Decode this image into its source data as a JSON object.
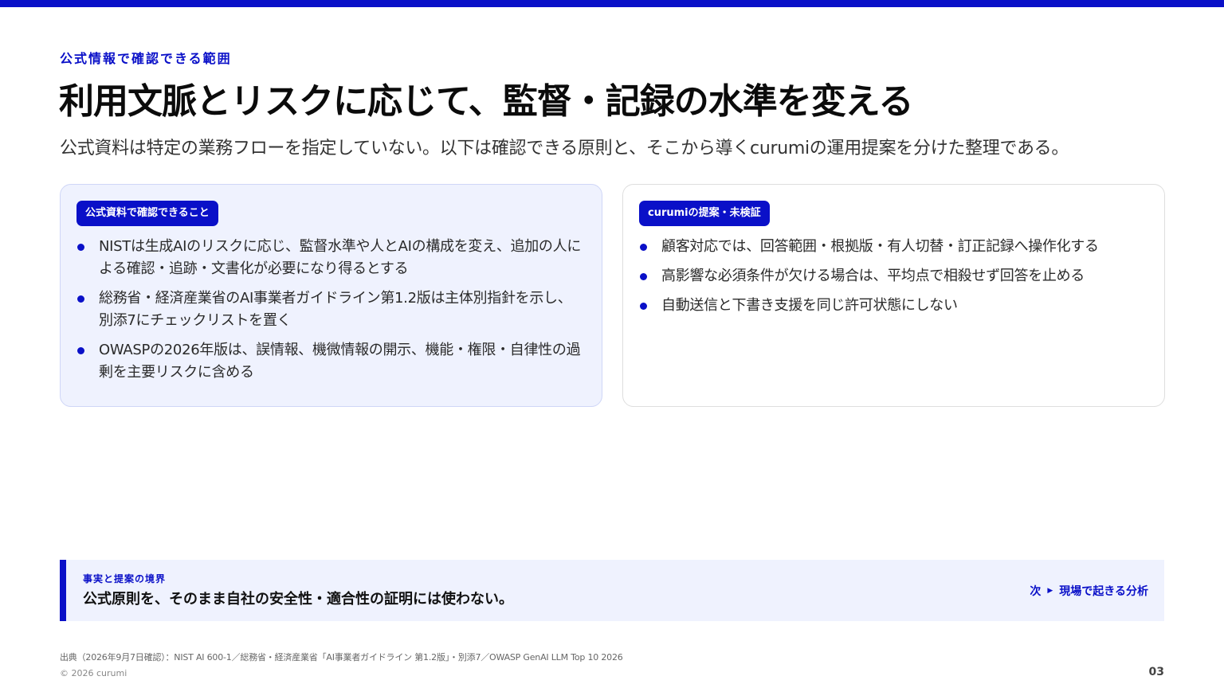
{
  "header": {
    "eyebrow": "公式情報で確認できる範囲",
    "title": "利用文脈とリスクに応じて、監督・記録の水準を変える",
    "subtitle": "公式資料は特定の業務フローを指定していない。以下は確認できる原則と、そこから導くcurumiの運用提案を分けた整理である。"
  },
  "cards": {
    "left": {
      "badge": "公式資料で確認できること",
      "items": [
        "NISTは生成AIのリスクに応じ、監督水準や人とAIの構成を変え、追加の人による確認・追跡・文書化が必要になり得るとする",
        "総務省・経済産業省のAI事業者ガイドライン第1.2版は主体別指針を示し、別添7にチェックリストを置く",
        "OWASPの2026年版は、誤情報、機微情報の開示、機能・権限・自律性の過剰を主要リスクに含める"
      ]
    },
    "right": {
      "badge": "curumiの提案・未検証",
      "items": [
        "顧客対応では、回答範囲・根拠版・有人切替・訂正記録へ操作化する",
        "高影響な必須条件が欠ける場合は、平均点で相殺せず回答を止める",
        "自動送信と下書き支援を同じ許可状態にしない"
      ]
    }
  },
  "note": {
    "label": "事実と提案の境界",
    "text": "公式原則を、そのまま自社の安全性・適合性の証明には使わない。",
    "next_prefix": "次",
    "next_label": "現場で起きる分析"
  },
  "footer": {
    "source": "出典（2026年9月7日確認）：NIST AI 600-1／総務省・経済産業省「AI事業者ガイドライン 第1.2版」・別添7／OWASP GenAI LLM Top 10 2026",
    "copyright": "© 2026 curumi",
    "page": "03"
  },
  "colors": {
    "accent": "#0a10c8",
    "panel": "#eff2fe"
  }
}
